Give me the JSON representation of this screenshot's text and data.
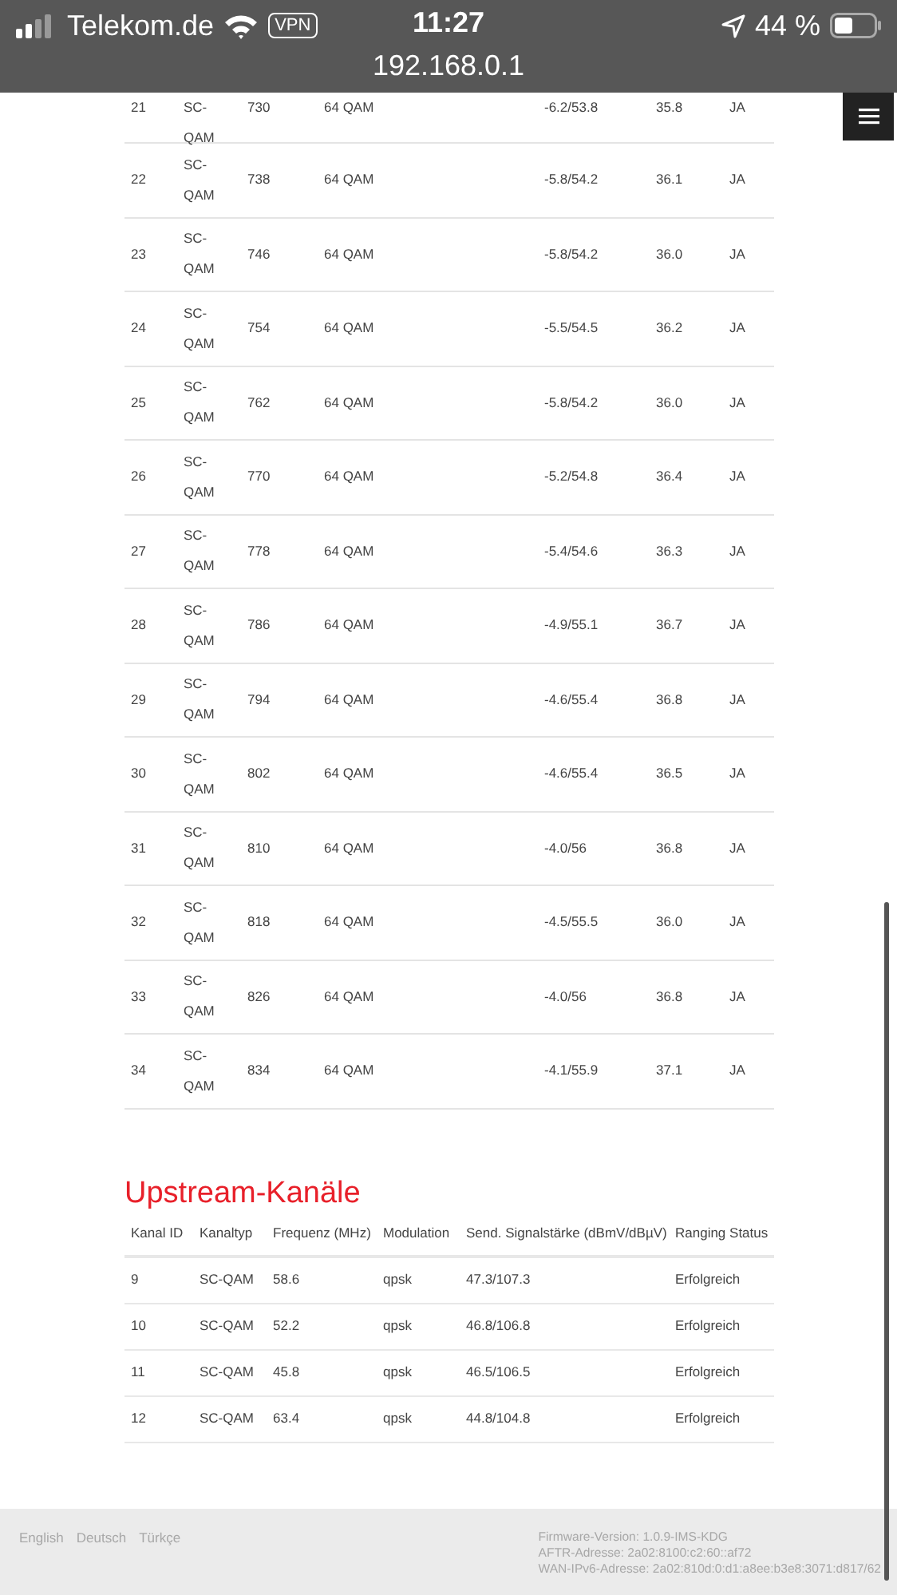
{
  "status_bar": {
    "carrier": "Telekom.de",
    "vpn": "VPN",
    "time": "11:27",
    "battery": "44 %",
    "url": "192.168.0.1"
  },
  "downstream_table": {
    "rows": [
      {
        "cells": [
          "21",
          "SC-QAM",
          "730",
          "64 QAM",
          "-6.2/53.8",
          "35.8",
          "JA"
        ]
      },
      {
        "cells": [
          "22",
          "SC-QAM",
          "738",
          "64 QAM",
          "-5.8/54.2",
          "36.1",
          "JA"
        ]
      },
      {
        "cells": [
          "23",
          "SC-QAM",
          "746",
          "64 QAM",
          "-5.8/54.2",
          "36.0",
          "JA"
        ]
      },
      {
        "cells": [
          "24",
          "SC-QAM",
          "754",
          "64 QAM",
          "-5.5/54.5",
          "36.2",
          "JA"
        ]
      },
      {
        "cells": [
          "25",
          "SC-QAM",
          "762",
          "64 QAM",
          "-5.8/54.2",
          "36.0",
          "JA"
        ]
      },
      {
        "cells": [
          "26",
          "SC-QAM",
          "770",
          "64 QAM",
          "-5.2/54.8",
          "36.4",
          "JA"
        ]
      },
      {
        "cells": [
          "27",
          "SC-QAM",
          "778",
          "64 QAM",
          "-5.4/54.6",
          "36.3",
          "JA"
        ]
      },
      {
        "cells": [
          "28",
          "SC-QAM",
          "786",
          "64 QAM",
          "-4.9/55.1",
          "36.7",
          "JA"
        ]
      },
      {
        "cells": [
          "29",
          "SC-QAM",
          "794",
          "64 QAM",
          "-4.6/55.4",
          "36.8",
          "JA"
        ]
      },
      {
        "cells": [
          "30",
          "SC-QAM",
          "802",
          "64 QAM",
          "-4.6/55.4",
          "36.5",
          "JA"
        ]
      },
      {
        "cells": [
          "31",
          "SC-QAM",
          "810",
          "64 QAM",
          "-4.0/56",
          "36.8",
          "JA"
        ]
      },
      {
        "cells": [
          "32",
          "SC-QAM",
          "818",
          "64 QAM",
          "-4.5/55.5",
          "36.0",
          "JA"
        ]
      },
      {
        "cells": [
          "33",
          "SC-QAM",
          "826",
          "64 QAM",
          "-4.0/56",
          "36.8",
          "JA"
        ]
      },
      {
        "cells": [
          "34",
          "SC-QAM",
          "834",
          "64 QAM",
          "-4.1/55.9",
          "37.1",
          "JA"
        ]
      }
    ]
  },
  "upstream": {
    "title": "Upstream-Kanäle",
    "columns": [
      "Kanal ID",
      "Kanaltyp",
      "Frequenz (MHz)",
      "Modulation",
      "Send. Signalstärke (dBmV/dBµV)",
      "Ranging Status"
    ],
    "rows": [
      {
        "cells": [
          "9",
          "SC-QAM",
          "58.6",
          "qpsk",
          "47.3/107.3",
          "Erfolgreich"
        ]
      },
      {
        "cells": [
          "10",
          "SC-QAM",
          "52.2",
          "qpsk",
          "46.8/106.8",
          "Erfolgreich"
        ]
      },
      {
        "cells": [
          "11",
          "SC-QAM",
          "45.8",
          "qpsk",
          "46.5/106.5",
          "Erfolgreich"
        ]
      },
      {
        "cells": [
          "12",
          "SC-QAM",
          "63.4",
          "qpsk",
          "44.8/104.8",
          "Erfolgreich"
        ]
      }
    ]
  },
  "footer": {
    "languages": [
      "English",
      "Deutsch",
      "Türkçe"
    ],
    "info": [
      "Firmware-Version: 1.0.9-IMS-KDG",
      "AFTR-Adresse: 2a02:8100:c2:60::af72",
      "WAN-IPv6-Adresse: 2a02:810d:0:d1:a8ee:b3e8:3071:d817/62"
    ]
  }
}
